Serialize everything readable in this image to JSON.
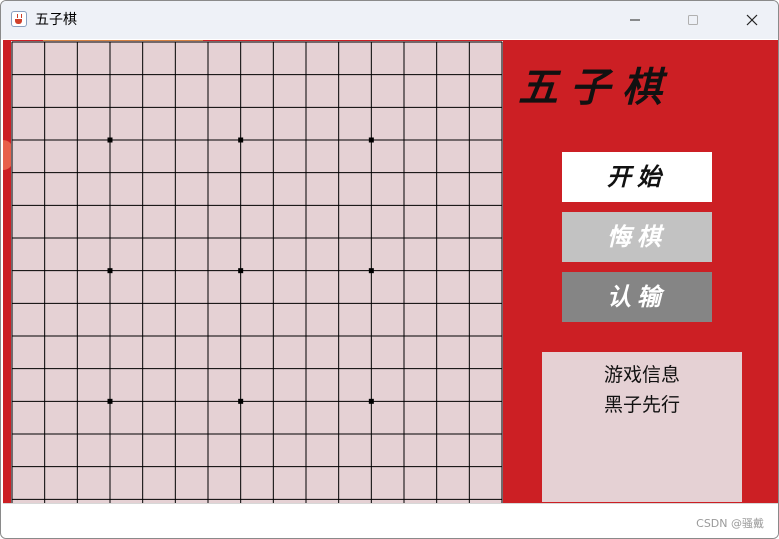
{
  "window": {
    "title": "五子棋",
    "icon": "java-cup-icon",
    "controls": [
      "minimize-icon",
      "maximize-icon",
      "close-icon"
    ]
  },
  "board": {
    "lines": 15,
    "grid_color": "#000000",
    "background": "#e5d1d4",
    "star_points": [
      [
        3,
        3
      ],
      [
        7,
        3
      ],
      [
        11,
        3
      ],
      [
        3,
        7
      ],
      [
        7,
        7
      ],
      [
        11,
        7
      ],
      [
        3,
        11
      ],
      [
        7,
        11
      ],
      [
        11,
        11
      ]
    ],
    "stones": []
  },
  "panel": {
    "title": "五子棋",
    "buttons": {
      "start": "开始",
      "undo": "悔棋",
      "resign": "认输"
    },
    "info": {
      "heading": "游戏信息",
      "status": "黑子先行"
    }
  },
  "colors": {
    "background": "#cc1f24",
    "start_button": "#ffffff",
    "undo_button": "#c2c2c2",
    "resign_button": "#858585"
  },
  "footer": {
    "watermark": "CSDN @骚戴"
  }
}
